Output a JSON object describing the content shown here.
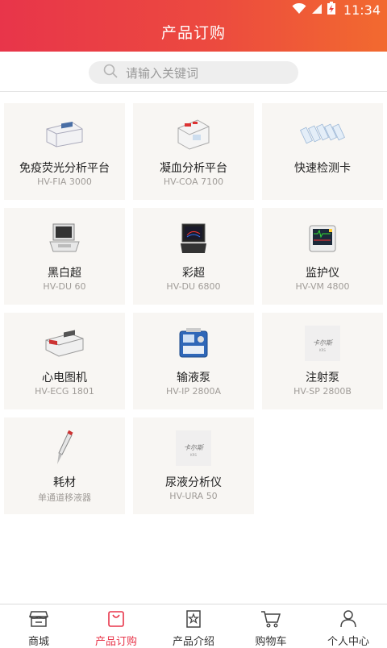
{
  "status": {
    "time": "11:34"
  },
  "header": {
    "title": "产品订购"
  },
  "search": {
    "placeholder": "请输入关键词"
  },
  "products": [
    {
      "name": "免疫荧光分析平台",
      "model": "HV-FIA 3000",
      "icon": "fluorescence-analyzer-icon"
    },
    {
      "name": "凝血分析平台",
      "model": "HV-COA 7100",
      "icon": "coagulation-analyzer-icon"
    },
    {
      "name": "快速检测卡",
      "model": "",
      "icon": "test-cards-icon"
    },
    {
      "name": "黑白超",
      "model": "HV-DU 60",
      "icon": "bw-ultrasound-icon"
    },
    {
      "name": "彩超",
      "model": "HV-DU 6800",
      "icon": "color-ultrasound-icon"
    },
    {
      "name": "监护仪",
      "model": "HV-VM 4800",
      "icon": "patient-monitor-icon"
    },
    {
      "name": "心电图机",
      "model": "HV-ECG 1801",
      "icon": "ecg-machine-icon"
    },
    {
      "name": "输液泵",
      "model": "HV-IP 2800A",
      "icon": "infusion-pump-icon"
    },
    {
      "name": "注射泵",
      "model": "HV-SP 2800B",
      "icon": "syringe-pump-icon"
    },
    {
      "name": "耗材",
      "model": "单通道移液器",
      "icon": "pipette-icon"
    },
    {
      "name": "尿液分析仪",
      "model": "HV-URA 50",
      "icon": "urine-analyzer-icon"
    }
  ],
  "placeholder_logo": "卡尔斯",
  "tabs": [
    {
      "label": "商城",
      "icon": "store-icon"
    },
    {
      "label": "产品订购",
      "icon": "shopping-bag-icon"
    },
    {
      "label": "产品介绍",
      "icon": "product-intro-icon"
    },
    {
      "label": "购物车",
      "icon": "cart-icon"
    },
    {
      "label": "个人中心",
      "icon": "user-icon"
    }
  ],
  "colors": {
    "accent": "#e8354a",
    "header_end": "#f26a2f",
    "card_bg": "#f8f6f3"
  }
}
